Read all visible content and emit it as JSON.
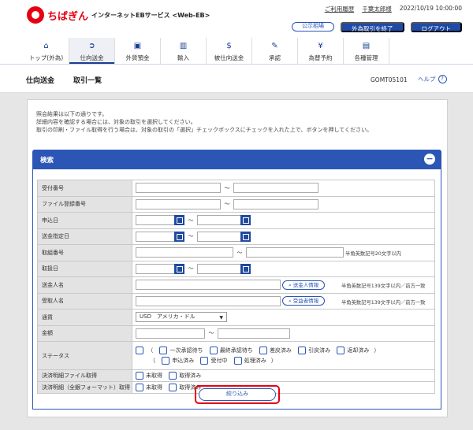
{
  "header": {
    "brand": "ちばぎん",
    "service": "インターネットEBサービス <Web-EB>",
    "links": [
      "ご利用履歴",
      "千葉太郎様",
      "2022/10/19 10:00:00"
    ],
    "buttons": {
      "rates": "公示相場",
      "end_forex": "外為取引を終了",
      "logout": "ログアウト"
    }
  },
  "nav": [
    {
      "label": "トップ(外為)",
      "icon": "home-icon"
    },
    {
      "label": "仕向送金",
      "icon": "remit-icon",
      "active": true
    },
    {
      "label": "外貨預金",
      "icon": "deposit-icon"
    },
    {
      "label": "輸入",
      "icon": "import-icon"
    },
    {
      "label": "被仕向送金",
      "icon": "inbound-icon"
    },
    {
      "label": "承認",
      "icon": "approve-icon"
    },
    {
      "label": "為替予約",
      "icon": "reserve-icon"
    },
    {
      "label": "各種管理",
      "icon": "manage-icon"
    }
  ],
  "title": {
    "crumb1": "仕向送金",
    "crumb2": "取引一覧",
    "screen_id": "GOMT05101",
    "help": "ヘルプ"
  },
  "notes": [
    "照会結果は以下の通りです。",
    "詳細内容を確認する場合には、対象の取引を選択してください。",
    "取引の印刷・ファイル取得を行う場合は、対象の取引の「選択」チェックボックスにチェックを入れた上で、ボタンを押してください。"
  ],
  "search": {
    "title": "検索",
    "fields": {
      "receipt_no": "受付番号",
      "file_reg_no": "ファイル登録番号",
      "apply_date": "申込日",
      "remit_date": "送金指定日",
      "ref_no": "取組番号",
      "ref_date": "取扱日",
      "remitter": "送金人名",
      "payee": "受取人名",
      "currency": "通貨",
      "amount": "金額",
      "status": "ステータス",
      "settle_file": "決済明細ファイル取得",
      "settle_all": "決済明細（全銀フォーマット）取得"
    },
    "tilde": "～",
    "hint_ref": "半角英数記号20文字以内",
    "hint_name": "半角英数記号139文字以内／前方一致",
    "btn_remitter": "送金人情報",
    "btn_payee": "受益者情報",
    "currency_value": "USD　アメリカ・ドル",
    "status_options": {
      "paren_open": "（",
      "paren_close": "）",
      "pending_first": "一次承認待ち",
      "pending_final": "最終承認待ち",
      "returned": "差戻済み",
      "withdrawn": "引戻済み",
      "rejected": "返却済み",
      "applied": "申込済み",
      "accepted": "受付中",
      "processed": "処理済み"
    },
    "not_obtained": "未取得",
    "obtained": "取得済み",
    "submit": "絞り込み"
  }
}
